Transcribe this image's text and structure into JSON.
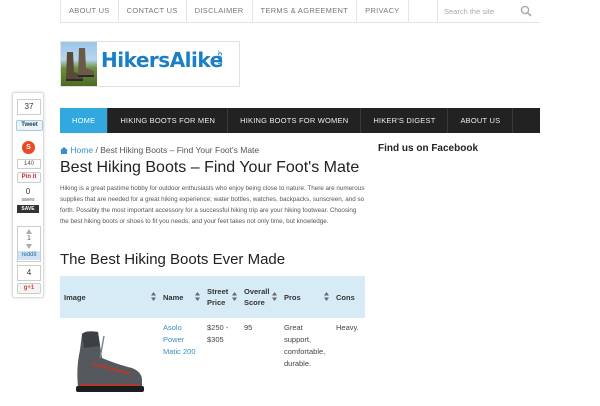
{
  "topbar": {
    "items": [
      "ABOUT US",
      "CONTACT US",
      "DISCLAIMER",
      "TERMS & AGREEMENT",
      "PRIVACY"
    ],
    "search_placeholder": "Search the site"
  },
  "logo": {
    "text": "HikersAlike",
    "suffix": ".com"
  },
  "mainnav": {
    "items": [
      "HOME",
      "HIKING BOOTS FOR MEN",
      "HIKING BOOTS FOR WOMEN",
      "HIKER'S DIGEST",
      "ABOUT US"
    ],
    "active": "HOME",
    "active_color": "#32a9de"
  },
  "social": {
    "share_count": "37",
    "tweet_label": "Tweet",
    "stumble_count": "140",
    "pin_label": "Pin it",
    "save_count": "0",
    "save_sub": "saves",
    "save_label": "SAVE",
    "reddit_count": "1",
    "reddit_label": "reddit",
    "gplus_count": "4",
    "gplus_label": "g+1"
  },
  "breadcrumb": {
    "home": "Home",
    "separator": "/",
    "current": "Best Hiking Boots – Find Your Foot's Mate"
  },
  "page_title": "Best Hiking Boots – Find Your Foot's Mate",
  "intro": "Hiking is a great pastime hobby for outdoor enthusiasts who enjoy being close to nature. There are numerous supplies that are needed for a great hiking experience; water bottles, watches, backpacks, sunscreen, and so forth. Possibly the most important accessory for a successful hiking trip are your hiking footwear. Choosing the best hiking boots or shoes to fit you needs, and your feet takes not only time, but knowledge.",
  "section_title": "The Best Hiking Boots Ever Made",
  "table": {
    "headers": [
      "Image",
      "Name",
      "Street Price",
      "Overall Score",
      "Pros",
      "Cons"
    ],
    "rows": [
      {
        "name": "Asolo Power Matic 200",
        "price": "$250 - $305",
        "score": "95",
        "pros": "Great support, comfortable, durable.",
        "cons": "Heavy."
      }
    ]
  },
  "sidebar": {
    "title": "Find us on Facebook"
  }
}
